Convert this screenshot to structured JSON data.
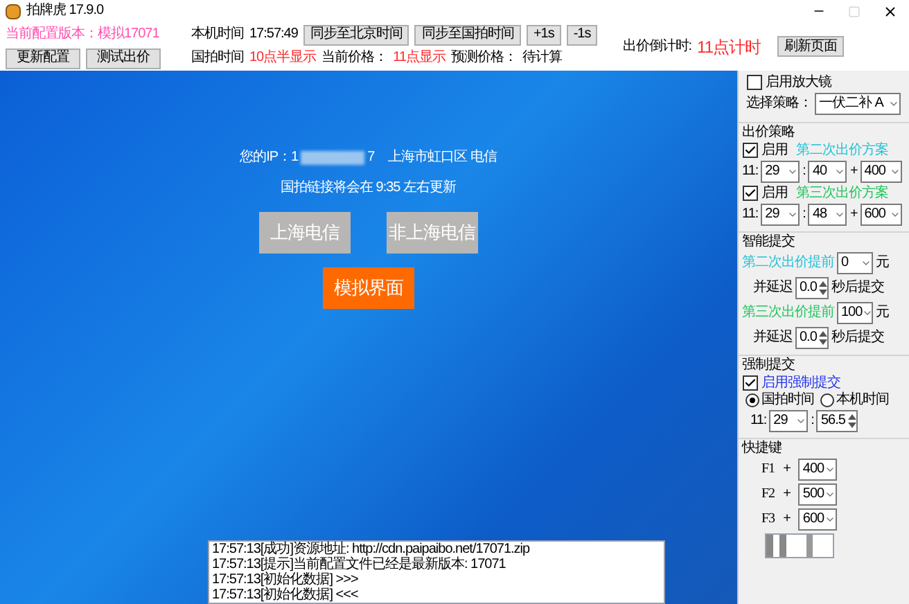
{
  "window": {
    "title": "拍牌虎 17.9.0"
  },
  "header": {
    "config_version": "当前配置版本：模拟17071",
    "local_time_label": "本机时间",
    "local_time": "17:57:49",
    "sync_buttons": [
      "同步至北京时间",
      "同步至国拍时间",
      "+1s",
      "-1s"
    ],
    "action_buttons": [
      "更新配置",
      "测试出价"
    ],
    "auction_time_label": "国拍时间",
    "auction_time": "10点半显示",
    "current_price_label": "当前价格：",
    "current_price": "11点显示",
    "predicted_price_label": "预测价格：",
    "predicted_price": "待计算",
    "countdown_label": "出价倒计时:",
    "countdown": "11点计时",
    "refresh_button": "刷新页面"
  },
  "main": {
    "ip_label": "您的IP：1",
    "ip_tail": "7",
    "location": "上海市虹口区 电信",
    "update_notice": "国拍链接将会在 9:35 左右更新",
    "options": [
      "上海电信",
      "非上海电信"
    ],
    "simulate_button": "模拟界面"
  },
  "log": [
    "17:57:13[成功]资源地址: http://cdn.paipaibo.net/17071.zip",
    "17:57:13[提示]当前配置文件已经是最新版本: 17071",
    "17:57:13[初始化数据] >>>",
    "17:57:13[初始化数据] <<<"
  ],
  "panel": {
    "magnifier": {
      "label": "启用放大镜",
      "checked": false
    },
    "strategy_label": "选择策略：",
    "strategy": "一伏二补 A",
    "bid_strategy": {
      "title": "出价策略",
      "plans": [
        {
          "enabled_label": "启用",
          "checked": true,
          "name": "第二次出价方案",
          "color": "#22c3d8",
          "hour": "11:",
          "minute": "29",
          "separator": ":",
          "second": "40",
          "plus": "+",
          "add": "400"
        },
        {
          "enabled_label": "启用",
          "checked": true,
          "name": "第三次出价方案",
          "color": "#22c55e",
          "hour": "11:",
          "minute": "29",
          "separator": ":",
          "second": "48",
          "plus": "+",
          "add": "600"
        }
      ]
    },
    "smart_submit": {
      "title": "智能提交",
      "items": [
        {
          "label": "第二次出价提前",
          "color": "#22c3d8",
          "value": "0",
          "unit": "元",
          "delay_label": "并延迟",
          "delay": "0.0",
          "after": "秒后提交"
        },
        {
          "label": "第三次出价提前",
          "color": "#22c55e",
          "value": "100",
          "unit": "元",
          "delay_label": "并延迟",
          "delay": "0.0",
          "after": "秒后提交"
        }
      ]
    },
    "forced_submit": {
      "title": "强制提交",
      "checkbox": {
        "label": "启用强制提交",
        "checked": true
      },
      "time_sources": [
        {
          "label": "国拍时间",
          "selected": true
        },
        {
          "label": "本机时间",
          "selected": false
        }
      ],
      "hour": "11:",
      "minute": "29",
      "separator": ":",
      "second": "56.5"
    },
    "hotkeys": {
      "title": "快捷键",
      "keys": [
        {
          "key": "F1",
          "plus": "+",
          "value": "400"
        },
        {
          "key": "F2",
          "plus": "+",
          "value": "500"
        },
        {
          "key": "F3",
          "plus": "+",
          "value": "600"
        }
      ]
    }
  }
}
